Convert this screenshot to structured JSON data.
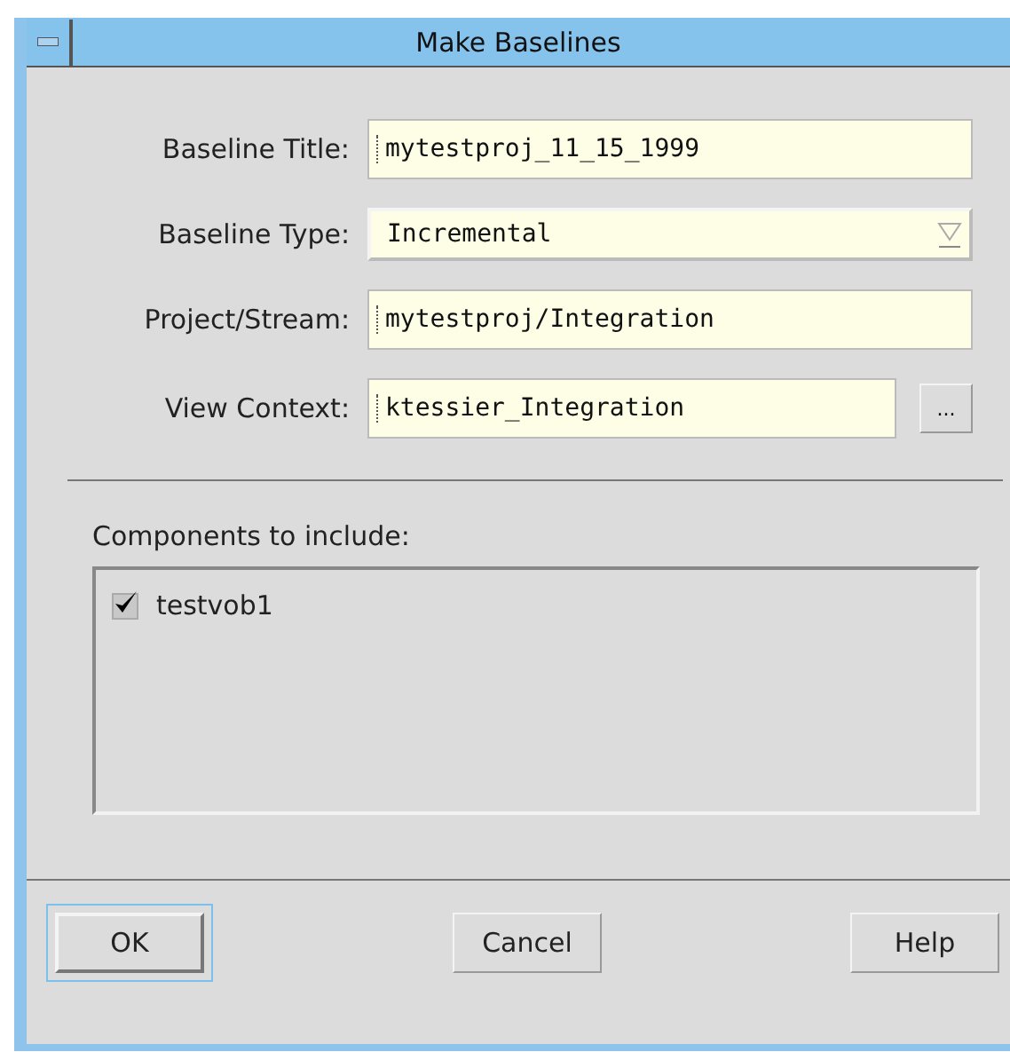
{
  "window": {
    "title": "Make Baselines"
  },
  "fields": [
    {
      "label": "Baseline Title:",
      "kind": "text",
      "value": "mytestproj_11_15_1999"
    },
    {
      "label": "Baseline Type:",
      "kind": "dropdown",
      "value": "Incremental"
    },
    {
      "label": "Project/Stream:",
      "kind": "text",
      "value": "mytestproj/Integration"
    },
    {
      "label": "View Context:",
      "kind": "browse",
      "value": "ktessier_Integration",
      "button": "..."
    }
  ],
  "components": {
    "label": "Components to include:",
    "items": [
      {
        "name": "testvob1",
        "checked": true
      }
    ]
  },
  "buttons": [
    {
      "label": "OK",
      "selected": true
    },
    {
      "label": "Cancel",
      "selected": false
    },
    {
      "label": "Help",
      "selected": false
    }
  ]
}
